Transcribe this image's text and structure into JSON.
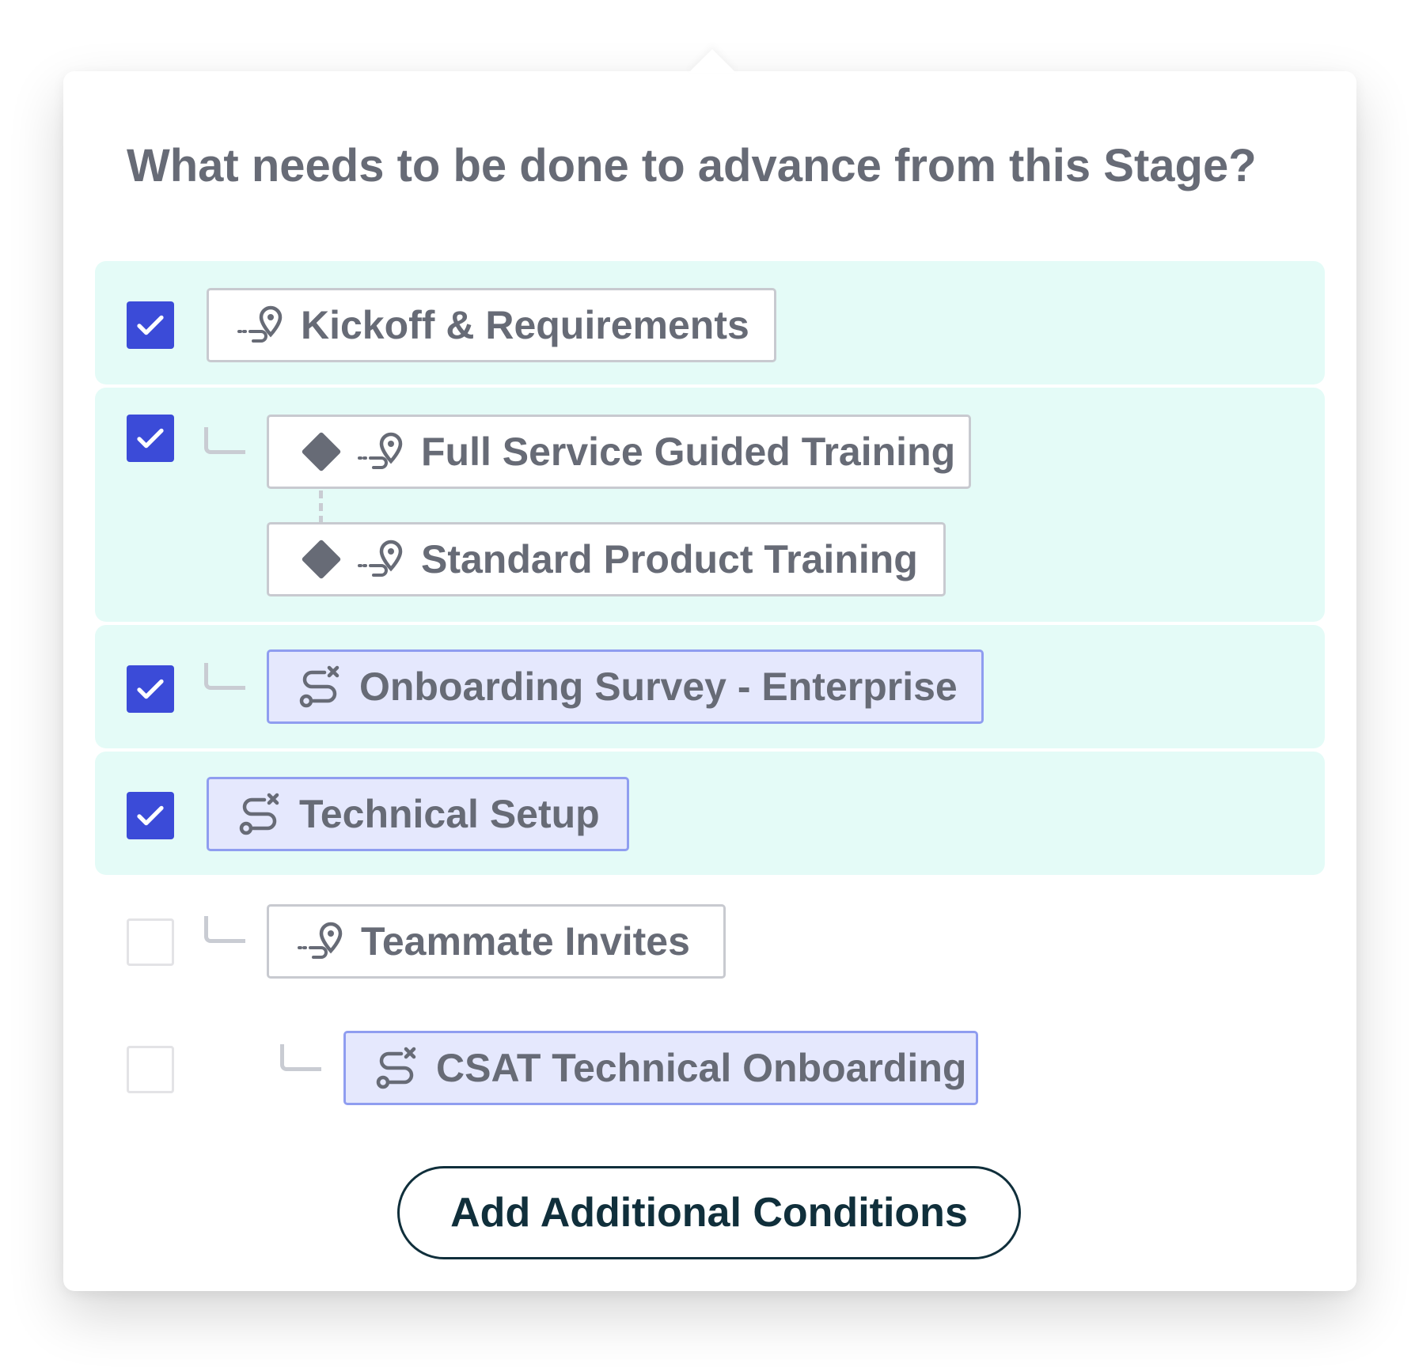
{
  "popover": {
    "title": "What needs to be done to advance from this Stage?"
  },
  "conditions": [
    {
      "label": "Kickoff & Requirements",
      "checked": true,
      "type": "milestone",
      "icon": "milestone-pin-icon"
    },
    {
      "label": "Full Service Guided Training",
      "checked": true,
      "type": "milestone",
      "option": true,
      "icon": "milestone-pin-icon"
    },
    {
      "label": "Standard Product Training",
      "type": "milestone",
      "option": true,
      "icon": "milestone-pin-icon"
    },
    {
      "label": "Onboarding Survey - Enterprise",
      "checked": true,
      "type": "survey",
      "icon": "survey-route-icon"
    },
    {
      "label": "Technical Setup",
      "checked": true,
      "type": "survey",
      "icon": "survey-route-icon"
    },
    {
      "label": "Teammate Invites",
      "checked": false,
      "type": "milestone",
      "icon": "milestone-pin-icon"
    },
    {
      "label": "CSAT Technical Onboarding",
      "checked": false,
      "type": "survey",
      "icon": "survey-route-icon"
    }
  ],
  "actions": {
    "add_label": "Add Additional Conditions"
  },
  "colors": {
    "checkbox_checked": "#3b4bd8",
    "completed_row_bg": "#e4fbf7",
    "survey_chip_bg": "#e5e8fd",
    "survey_chip_border": "#8f9df0",
    "button_text": "#102f3b",
    "chip_text": "#676b76"
  }
}
